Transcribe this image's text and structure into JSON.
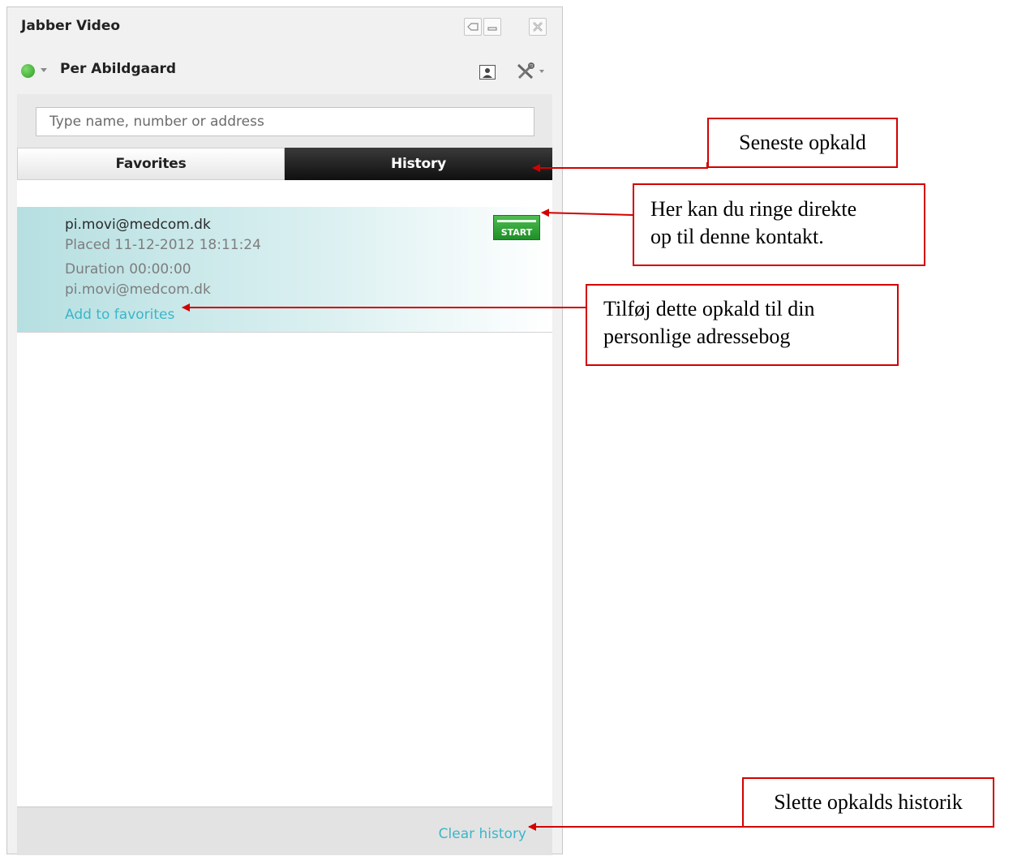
{
  "window": {
    "title": "Jabber Video",
    "user_name": "Per Abildgaard",
    "status_color": "#2e9a27"
  },
  "search": {
    "placeholder": "Type name, number or address"
  },
  "tabs": [
    {
      "label": "Favorites",
      "active": false
    },
    {
      "label": "History",
      "active": true
    }
  ],
  "history": [
    {
      "name": "pi.movi@medcom.dk",
      "placed": "Placed 11-12-2012 18:11:24",
      "duration": "Duration 00:00:00",
      "address": "pi.movi@medcom.dk",
      "add_link": "Add to favorites",
      "start_label": "START"
    }
  ],
  "footer": {
    "clear_label": "Clear history"
  },
  "annotations": {
    "tab_note": "Seneste opkald",
    "start_note_line1": "Her kan du ringe direkte",
    "start_note_line2": "op til denne kontakt.",
    "add_note_line1": "Tilføj dette opkald til din",
    "add_note_line2": "personlige adressebog",
    "clear_note": "Slette opkalds historik"
  },
  "colors": {
    "link": "#3bb6c8",
    "annotation_red": "#d20000",
    "start_green": "#1f8e27"
  },
  "icons": [
    "restore-icon",
    "minimize-icon",
    "close-icon",
    "self-view-icon",
    "settings-icon"
  ]
}
